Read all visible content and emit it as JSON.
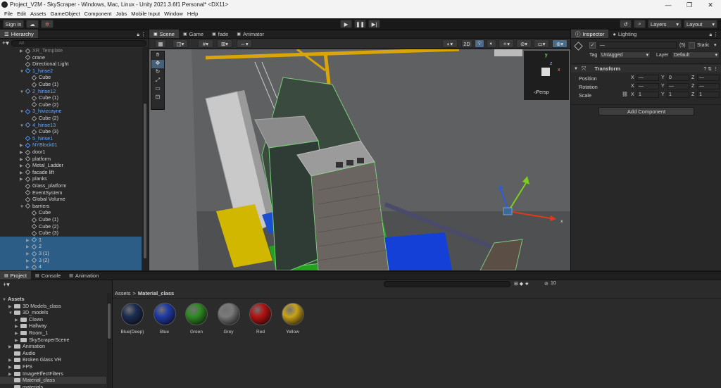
{
  "window": {
    "title": "Project_V2M - SkyScraper - Windows, Mac, Linux - Unity 2021.3.6f1 Personal* <DX11>"
  },
  "menu": [
    "File",
    "Edit",
    "Assets",
    "GameObject",
    "Component",
    "Jobs",
    "Mobile Input",
    "Window",
    "Help"
  ],
  "toolbar": {
    "sign_in": "Sign in",
    "layers": "Layers",
    "layout": "Layout"
  },
  "hierarchy": {
    "tab": "Hierarchy",
    "search_placeholder": "All",
    "items": [
      {
        "label": "XR_Template",
        "indent": 2,
        "kind": "obj",
        "style": "grey",
        "arrow": "▶",
        "sel": false
      },
      {
        "label": "crane",
        "indent": 2,
        "kind": "obj",
        "style": "",
        "arrow": "",
        "sel": false
      },
      {
        "label": "Directional Light",
        "indent": 2,
        "kind": "obj",
        "style": "",
        "arrow": "",
        "sel": false
      },
      {
        "label": "1_hirise2",
        "indent": 2,
        "kind": "prefab",
        "style": "blue",
        "arrow": "▼",
        "sel": false
      },
      {
        "label": "Cube",
        "indent": 3,
        "kind": "obj",
        "style": "",
        "arrow": "",
        "sel": false
      },
      {
        "label": "Cube (1)",
        "indent": 3,
        "kind": "obj",
        "style": "",
        "arrow": "",
        "sel": false
      },
      {
        "label": "2_hirise12",
        "indent": 2,
        "kind": "prefab",
        "style": "blue",
        "arrow": "▼",
        "sel": false
      },
      {
        "label": "Cube (1)",
        "indent": 3,
        "kind": "obj",
        "style": "",
        "arrow": "",
        "sel": false
      },
      {
        "label": "Cube (2)",
        "indent": 3,
        "kind": "obj",
        "style": "",
        "arrow": "",
        "sel": false
      },
      {
        "label": "3_hivizcayne",
        "indent": 2,
        "kind": "prefab",
        "style": "blue",
        "arrow": "▼",
        "sel": false
      },
      {
        "label": "Cube (2)",
        "indent": 3,
        "kind": "obj",
        "style": "",
        "arrow": "",
        "sel": false
      },
      {
        "label": "4_hirise13",
        "indent": 2,
        "kind": "prefab",
        "style": "blue",
        "arrow": "▼",
        "sel": false
      },
      {
        "label": "Cube (3)",
        "indent": 3,
        "kind": "obj",
        "style": "",
        "arrow": "",
        "sel": false
      },
      {
        "label": "5_hirise1",
        "indent": 2,
        "kind": "prefab",
        "style": "blue",
        "arrow": "",
        "sel": false
      },
      {
        "label": "NYBlock01",
        "indent": 2,
        "kind": "prefab",
        "style": "blue",
        "arrow": "▶",
        "sel": false
      },
      {
        "label": "door1",
        "indent": 2,
        "kind": "obj",
        "style": "",
        "arrow": "▶",
        "sel": false
      },
      {
        "label": "platform",
        "indent": 2,
        "kind": "obj",
        "style": "",
        "arrow": "▶",
        "sel": false
      },
      {
        "label": "Metal_Ladder",
        "indent": 2,
        "kind": "obj",
        "style": "",
        "arrow": "▶",
        "sel": false
      },
      {
        "label": "facade lift",
        "indent": 2,
        "kind": "obj",
        "style": "",
        "arrow": "▶",
        "sel": false
      },
      {
        "label": "planks",
        "indent": 2,
        "kind": "obj",
        "style": "",
        "arrow": "▶",
        "sel": false
      },
      {
        "label": "Glass_platform",
        "indent": 2,
        "kind": "obj",
        "style": "",
        "arrow": "",
        "sel": false
      },
      {
        "label": "EventSystem",
        "indent": 2,
        "kind": "obj",
        "style": "",
        "arrow": "",
        "sel": false
      },
      {
        "label": "Global Volume",
        "indent": 2,
        "kind": "obj",
        "style": "",
        "arrow": "",
        "sel": false
      },
      {
        "label": "barriers",
        "indent": 2,
        "kind": "obj",
        "style": "",
        "arrow": "▼",
        "sel": false
      },
      {
        "label": "Cube",
        "indent": 3,
        "kind": "obj",
        "style": "",
        "arrow": "",
        "sel": false
      },
      {
        "label": "Cube (1)",
        "indent": 3,
        "kind": "obj",
        "style": "",
        "arrow": "",
        "sel": false
      },
      {
        "label": "Cube (2)",
        "indent": 3,
        "kind": "obj",
        "style": "",
        "arrow": "",
        "sel": false
      },
      {
        "label": "Cube (3)",
        "indent": 3,
        "kind": "obj",
        "style": "",
        "arrow": "",
        "sel": false
      },
      {
        "label": "1",
        "indent": 3,
        "kind": "obj",
        "style": "",
        "arrow": "▶",
        "sel": true
      },
      {
        "label": "2",
        "indent": 3,
        "kind": "obj",
        "style": "",
        "arrow": "▶",
        "sel": true
      },
      {
        "label": "3 (1)",
        "indent": 3,
        "kind": "obj",
        "style": "",
        "arrow": "▶",
        "sel": true
      },
      {
        "label": "3 (2)",
        "indent": 3,
        "kind": "obj",
        "style": "",
        "arrow": "▶",
        "sel": true
      },
      {
        "label": "4",
        "indent": 3,
        "kind": "obj",
        "style": "",
        "arrow": "▶",
        "sel": true
      }
    ]
  },
  "scene": {
    "tabs": [
      "Scene",
      "Game",
      "fade",
      "Animator"
    ],
    "mode_2d": "2D",
    "persp": "◃Persp",
    "axis_y": "y",
    "axis_x": "x",
    "axis_z": "z",
    "gizmo_x": "x"
  },
  "inspector": {
    "tabs": [
      "Inspector",
      "Lighting"
    ],
    "name_value": "—",
    "count": "(5)",
    "static_label": "Static",
    "tag_label": "Tag",
    "tag_value": "Untagged",
    "layer_label": "Layer",
    "layer_value": "Default",
    "transform_title": "Transform",
    "rows": [
      {
        "label": "Position",
        "x": "—",
        "y": "0",
        "z": "—"
      },
      {
        "label": "Rotation",
        "x": "—",
        "y": "—",
        "z": "—"
      },
      {
        "label": "Scale",
        "x": "1",
        "y": "1",
        "z": "1"
      }
    ],
    "axis": [
      "X",
      "Y",
      "Z"
    ],
    "add_component": "Add Component"
  },
  "project": {
    "tabs": [
      "Project",
      "Console",
      "Animation"
    ],
    "breadcrumb_root": "Assets",
    "breadcrumb_sep": ">",
    "breadcrumb_current": "Material_class",
    "hidden_count": "10",
    "tree": [
      {
        "label": "Assets",
        "indent": 0,
        "arrow": "▼",
        "bold": true
      },
      {
        "label": "3D Models_class",
        "indent": 1,
        "arrow": "▶",
        "bold": false
      },
      {
        "label": "3D_models",
        "indent": 1,
        "arrow": "▼",
        "bold": false
      },
      {
        "label": "Clown",
        "indent": 2,
        "arrow": "▶",
        "bold": false
      },
      {
        "label": "Hallway",
        "indent": 2,
        "arrow": "▶",
        "bold": false
      },
      {
        "label": "Room_1",
        "indent": 2,
        "arrow": "▶",
        "bold": false
      },
      {
        "label": "SkyScraperScene",
        "indent": 2,
        "arrow": "▶",
        "bold": false
      },
      {
        "label": "Animation",
        "indent": 1,
        "arrow": "▶",
        "bold": false
      },
      {
        "label": "Audio",
        "indent": 1,
        "arrow": "",
        "bold": false
      },
      {
        "label": "Broken Glass VR",
        "indent": 1,
        "arrow": "▶",
        "bold": false
      },
      {
        "label": "FPS",
        "indent": 1,
        "arrow": "▶",
        "bold": false
      },
      {
        "label": "ImageEffectFilters",
        "indent": 1,
        "arrow": "▶",
        "bold": false
      },
      {
        "label": "Material_class",
        "indent": 1,
        "arrow": "",
        "bold": false
      },
      {
        "label": "materials",
        "indent": 1,
        "arrow": "",
        "bold": false
      }
    ],
    "materials": [
      {
        "label": "Blue(Deep)",
        "color": "#1c2c52"
      },
      {
        "label": "Blue",
        "color": "#1f3aa6"
      },
      {
        "label": "Green",
        "color": "#2f8a24"
      },
      {
        "label": "Grey",
        "color": "#7a7a7a"
      },
      {
        "label": "Red",
        "color": "#b31313"
      },
      {
        "label": "Yellow",
        "color": "#c8a21a"
      }
    ]
  }
}
